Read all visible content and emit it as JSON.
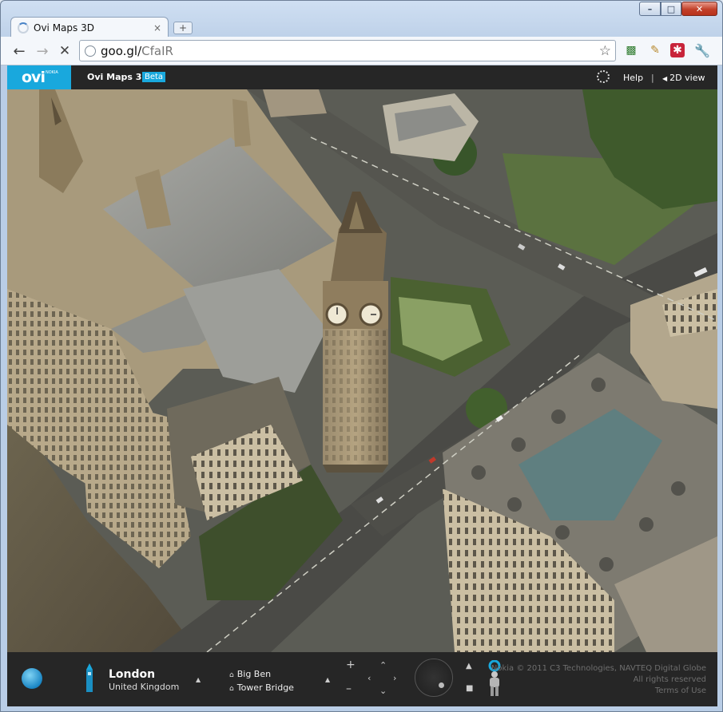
{
  "browser": {
    "tab_title": "Ovi Maps 3D",
    "tab_close": "×",
    "new_tab": "+",
    "url_host": "goo.gl/",
    "url_path": "CfaIR",
    "window_buttons": {
      "minimize": "–",
      "maximize": "□",
      "close": "✕"
    }
  },
  "header": {
    "logo": "ovi",
    "logo_sub": "NOKIA",
    "app_title": "Ovi Maps 3D",
    "beta_badge": "Beta",
    "help_label": "Help",
    "separator": "|",
    "view_toggle_label": "2D view"
  },
  "location": {
    "city": "London",
    "country": "United Kingdom"
  },
  "favorites": [
    {
      "label": "Big Ben"
    },
    {
      "label": "Tower Bridge"
    }
  ],
  "controls": {
    "zoom_in": "+",
    "zoom_out": "–"
  },
  "copyright": {
    "line1": "Nokia © 2011 C3 Technologies, NAVTEQ Digital Globe",
    "line2": "All rights reserved",
    "line3": "Terms of Use"
  },
  "colors": {
    "ovi_blue": "#19a8dd",
    "bar_dark": "#262626"
  },
  "map": {
    "landmark_clock": "Big Ben clock tower",
    "icons": [
      "globe-icon",
      "tower-icon",
      "pegman-icon"
    ]
  }
}
